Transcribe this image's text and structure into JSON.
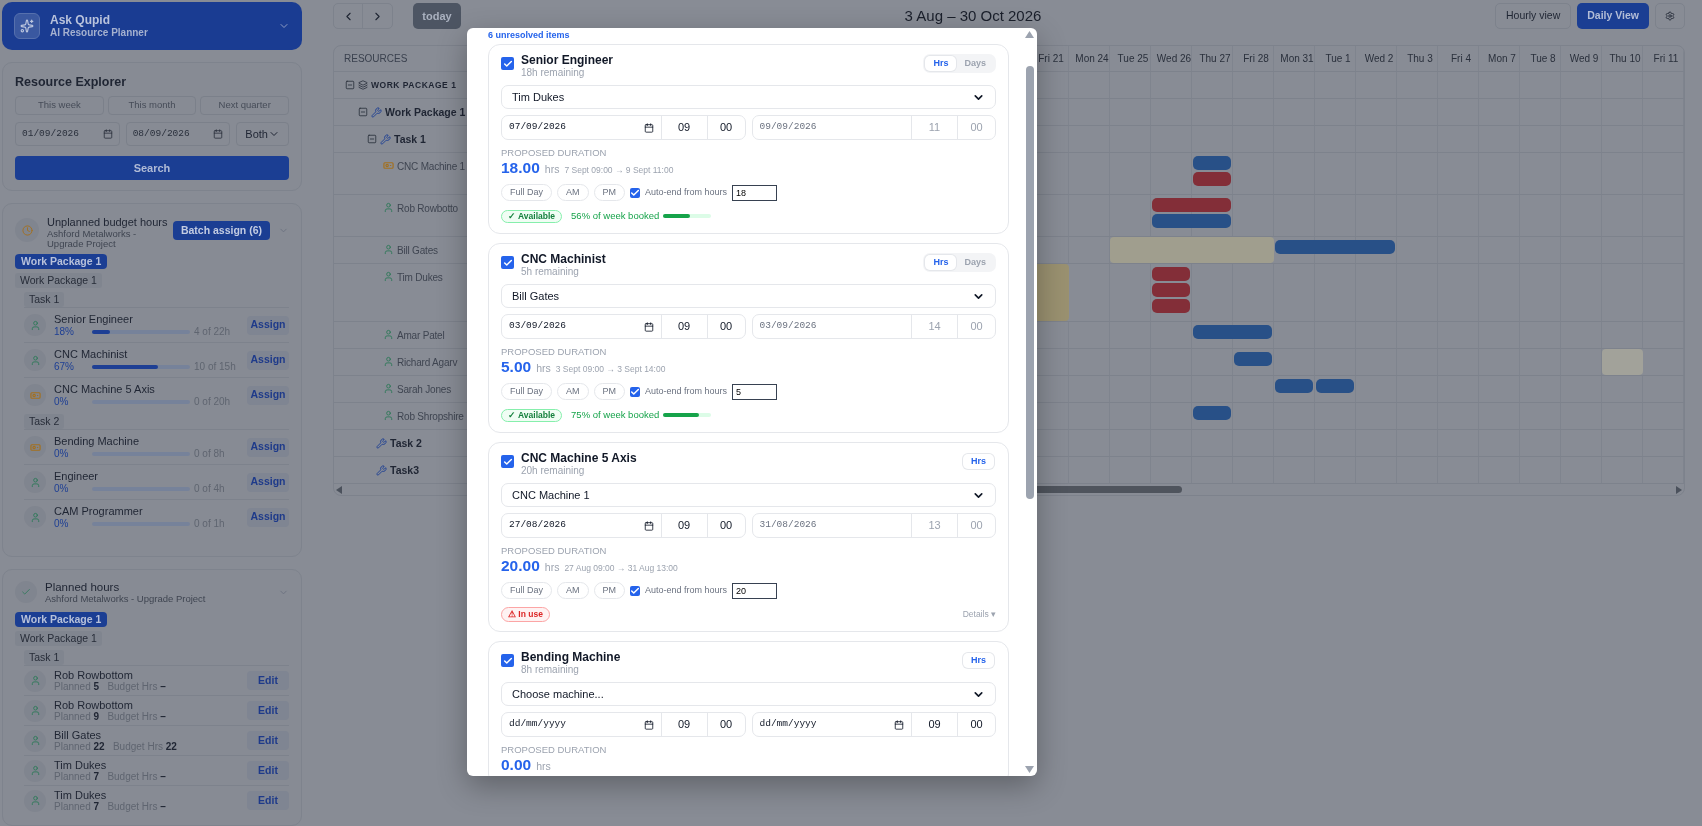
{
  "assistant": {
    "title": "Ask Qupid",
    "subtitle": "AI Resource Planner"
  },
  "explorer": {
    "title": "Resource Explorer",
    "ranges": [
      "This week",
      "This month",
      "Next quarter"
    ],
    "from": "01/09/2026",
    "to": "08/09/2026",
    "filter": "Both",
    "search": "Search"
  },
  "unplanned": {
    "title": "Unplanned budget hours",
    "subtitle": "Ashford Metalworks - Upgrade Project",
    "batch": "Batch assign (6)",
    "badge": "Work Package 1",
    "package": "Work Package 1",
    "tasks": [
      {
        "name": "Task 1",
        "items": [
          {
            "name": "Senior Engineer",
            "kind": "person",
            "percent": "18%",
            "level": 0.18,
            "hours": "4 of 22h",
            "action": "Assign"
          },
          {
            "name": "CNC Machinist",
            "kind": "person",
            "percent": "67%",
            "level": 0.67,
            "hours": "10 of 15h",
            "action": "Assign"
          },
          {
            "name": "CNC Machine 5 Axis",
            "kind": "machine",
            "percent": "0%",
            "level": 0,
            "hours": "0 of 20h",
            "action": "Assign"
          }
        ]
      },
      {
        "name": "Task 2",
        "items": [
          {
            "name": "Bending Machine",
            "kind": "machine",
            "percent": "0%",
            "level": 0,
            "hours": "0 of 8h",
            "action": "Assign"
          },
          {
            "name": "Engineer",
            "kind": "person",
            "percent": "0%",
            "level": 0,
            "hours": "0 of 4h",
            "action": "Assign"
          },
          {
            "name": "CAM Programmer",
            "kind": "person",
            "percent": "0%",
            "level": 0,
            "hours": "0 of 1h",
            "action": "Assign"
          }
        ]
      }
    ]
  },
  "planned": {
    "title": "Planned hours",
    "subtitle": "Ashford Metalworks - Upgrade Project",
    "badge": "Work Package 1",
    "package": "Work Package 1",
    "tasks": [
      {
        "name": "Task 1",
        "items": [
          {
            "name": "Rob Rowbottom",
            "kind": "person",
            "detail": "Planned **5**   Budget Hrs **–**",
            "action": "Edit"
          },
          {
            "name": "Rob Rowbottom",
            "kind": "person",
            "detail": "Planned **9**   Budget Hrs **–**",
            "action": "Edit"
          },
          {
            "name": "Bill Gates",
            "kind": "person",
            "detail": "Planned **22**   Budget Hrs **22**",
            "action": "Edit"
          },
          {
            "name": "Tim Dukes",
            "kind": "person",
            "detail": "Planned **7**   Budget Hrs **–**",
            "action": "Edit"
          },
          {
            "name": "Tim Dukes",
            "kind": "person",
            "detail": "Planned **7**   Budget Hrs **–**",
            "action": "Edit"
          }
        ]
      }
    ]
  },
  "toolbar": {
    "today": "today",
    "title": "3 Aug – 30 Oct 2026",
    "views": [
      {
        "label": "Hourly view",
        "selected": false
      },
      {
        "label": "Daily View",
        "selected": true
      }
    ]
  },
  "gantt": {
    "header": "RESOURCES",
    "days": [
      "Fri 21",
      "Mon 24",
      "Tue 25",
      "Wed 26",
      "Thu 27",
      "Fri 28",
      "Mon 31",
      "Tue 1",
      "Wed 2",
      "Thu 3",
      "Fri 4",
      "Mon 7",
      "Tue 8",
      "Wed 9",
      "Thu 10",
      "Fri 11"
    ],
    "rows": [
      {
        "label": "WORK PACKAGE 1",
        "kind": "package",
        "expanded": true,
        "children": [
          {
            "label": "Work Package 1",
            "kind": "subpackage",
            "expanded": true,
            "children": [
              {
                "label": "Task 1",
                "kind": "task",
                "expanded": true,
                "children": [
                  {
                    "label": "CNC Machine 1",
                    "kind": "machine",
                    "lanes": [
                      {
                        "bookings": [
                          {
                            "color": "#285087",
                            "days": [
                              false,
                              false,
                              false,
                              false,
                              true,
                              false,
                              false,
                              false,
                              false,
                              false,
                              false,
                              false,
                              false,
                              false,
                              false,
                              false
                            ]
                          }
                        ]
                      },
                      {
                        "bookings": [
                          {
                            "color": "#832e38",
                            "days": [
                              false,
                              false,
                              false,
                              false,
                              true,
                              false,
                              false,
                              false,
                              false,
                              false,
                              false,
                              false,
                              false,
                              false,
                              false,
                              false
                            ]
                          }
                        ]
                      }
                    ]
                  },
                  {
                    "label": "Rob Rowbotto",
                    "kind": "person",
                    "lanes": [
                      {
                        "bookings": [
                          {
                            "color": "#832e38",
                            "days": [
                              false,
                              false,
                              false,
                              true,
                              true,
                              false,
                              false,
                              false,
                              false,
                              false,
                              false,
                              false,
                              false,
                              false,
                              false,
                              false
                            ]
                          }
                        ]
                      },
                      {
                        "bookings": [
                          {
                            "color": "#285087",
                            "days": [
                              false,
                              false,
                              false,
                              true,
                              true,
                              false,
                              false,
                              false,
                              false,
                              false,
                              false,
                              false,
                              false,
                              false,
                              false,
                              false
                            ]
                          }
                        ]
                      }
                    ]
                  },
                  {
                    "label": "Bill Gates",
                    "kind": "person",
                    "blocks": [
                      {
                        "color": "#a09e8e",
                        "days": [
                          false,
                          false,
                          true,
                          true,
                          true,
                          true,
                          false,
                          false,
                          false,
                          false,
                          false,
                          false,
                          false,
                          false,
                          false,
                          false
                        ]
                      }
                    ],
                    "lanes": [
                      {
                        "bookings": [
                          {
                            "color": "#285087",
                            "days": [
                              false,
                              false,
                              false,
                              false,
                              false,
                              false,
                              true,
                              true,
                              true,
                              false,
                              false,
                              false,
                              false,
                              false,
                              false,
                              false
                            ]
                          }
                        ]
                      }
                    ]
                  },
                  {
                    "label": "Tim Dukes",
                    "kind": "person",
                    "blocks": [
                      {
                        "color": "#9a9170",
                        "days": [
                          true,
                          false,
                          false,
                          false,
                          false,
                          false,
                          false,
                          false,
                          false,
                          false,
                          false,
                          false,
                          false,
                          false,
                          false,
                          false
                        ]
                      }
                    ],
                    "lanes": [
                      {
                        "bookings": [
                          {
                            "color": "#832e38",
                            "days": [
                              false,
                              false,
                              false,
                              true,
                              false,
                              false,
                              false,
                              false,
                              false,
                              false,
                              false,
                              false,
                              false,
                              false,
                              false,
                              false
                            ]
                          }
                        ]
                      },
                      {
                        "bookings": [
                          {
                            "color": "#832e38",
                            "days": [
                              false,
                              false,
                              false,
                              true,
                              false,
                              false,
                              false,
                              false,
                              false,
                              false,
                              false,
                              false,
                              false,
                              false,
                              false,
                              false
                            ]
                          }
                        ]
                      },
                      {
                        "bookings": [
                          {
                            "color": "#832e38",
                            "days": [
                              false,
                              false,
                              false,
                              true,
                              false,
                              false,
                              false,
                              false,
                              false,
                              false,
                              false,
                              false,
                              false,
                              false,
                              false,
                              false
                            ]
                          }
                        ]
                      }
                    ]
                  },
                  {
                    "label": "Amar Patel",
                    "kind": "person",
                    "lanes": [
                      {
                        "bookings": [
                          {
                            "color": "#285087",
                            "days": [
                              false,
                              false,
                              false,
                              false,
                              true,
                              true,
                              false,
                              false,
                              false,
                              false,
                              false,
                              false,
                              false,
                              false,
                              false,
                              false
                            ]
                          }
                        ]
                      }
                    ]
                  },
                  {
                    "label": "Richard Agarv",
                    "kind": "person",
                    "blocks": [
                      {
                        "color": "#a2a29a",
                        "days": [
                          false,
                          false,
                          false,
                          false,
                          false,
                          false,
                          false,
                          false,
                          false,
                          false,
                          false,
                          false,
                          false,
                          false,
                          true,
                          false
                        ]
                      }
                    ],
                    "lanes": [
                      {
                        "bookings": [
                          {
                            "color": "#285087",
                            "days": [
                              false,
                              false,
                              false,
                              false,
                              false,
                              true,
                              false,
                              false,
                              false,
                              false,
                              false,
                              false,
                              false,
                              false,
                              false,
                              false
                            ]
                          }
                        ]
                      }
                    ]
                  },
                  {
                    "label": "Sarah Jones",
                    "kind": "person",
                    "lanes": [
                      {
                        "bookings": [
                          {
                            "color": "#285087",
                            "days": [
                              false,
                              false,
                              false,
                              false,
                              false,
                              false,
                              true,
                              false,
                              false,
                              false,
                              false,
                              false,
                              false,
                              false,
                              false,
                              false
                            ]
                          },
                          {
                            "color": "#285087",
                            "days": [
                              false,
                              false,
                              false,
                              false,
                              false,
                              false,
                              false,
                              true,
                              false,
                              false,
                              false,
                              false,
                              false,
                              false,
                              false,
                              false
                            ]
                          }
                        ]
                      }
                    ]
                  },
                  {
                    "label": "Rob Shropshire",
                    "kind": "person",
                    "lanes": [
                      {
                        "bookings": [
                          {
                            "color": "#285087",
                            "days": [
                              false,
                              false,
                              false,
                              false,
                              true,
                              false,
                              false,
                              false,
                              false,
                              false,
                              false,
                              false,
                              false,
                              false,
                              false,
                              false
                            ]
                          }
                        ]
                      }
                    ]
                  }
                ]
              },
              {
                "label": "Task 2",
                "kind": "task"
              },
              {
                "label": "Task3",
                "kind": "task"
              }
            ]
          }
        ]
      }
    ]
  },
  "modal": {
    "unresolved": "6 unresolved items",
    "cards": [
      {
        "title": "Senior Engineer",
        "remaining": "18h remaining",
        "checked": true,
        "units": [
          {
            "label": "Hrs",
            "selected": true
          },
          {
            "label": "Days",
            "selected": false
          }
        ],
        "assignee": "Tim Dukes",
        "start": {
          "date": "07/09/2026",
          "hour": "09",
          "minute": "00"
        },
        "end": {
          "date": "09/09/2026",
          "hour": "11",
          "minute": "00",
          "locked": true
        },
        "duration_label": "PROPOSED DURATION",
        "duration": "18.00",
        "unit": "hrs",
        "range": "7 Sept 09:00 → 9 Sept 11:00",
        "presets": [
          "Full Day",
          "AM",
          "PM"
        ],
        "auto_end": {
          "label": "Auto-end from hours",
          "checked": true,
          "value": "18"
        },
        "status": {
          "kind": "available",
          "badge": "✓ Available",
          "booked": "56% of week booked",
          "level": 0.56
        }
      },
      {
        "title": "CNC Machinist",
        "remaining": "5h remaining",
        "checked": true,
        "units": [
          {
            "label": "Hrs",
            "selected": true
          },
          {
            "label": "Days",
            "selected": false
          }
        ],
        "assignee": "Bill Gates",
        "start": {
          "date": "03/09/2026",
          "hour": "09",
          "minute": "00"
        },
        "end": {
          "date": "03/09/2026",
          "hour": "14",
          "minute": "00",
          "locked": true
        },
        "duration_label": "PROPOSED DURATION",
        "duration": "5.00",
        "unit": "hrs",
        "range": "3 Sept 09:00 → 3 Sept 14:00",
        "presets": [
          "Full Day",
          "AM",
          "PM"
        ],
        "auto_end": {
          "label": "Auto-end from hours",
          "checked": true,
          "value": "5"
        },
        "status": {
          "kind": "available",
          "badge": "✓ Available",
          "booked": "75% of week booked",
          "level": 0.75
        }
      },
      {
        "title": "CNC Machine 5 Axis",
        "remaining": "20h remaining",
        "checked": true,
        "units": [
          {
            "label": "Hrs",
            "selected": true
          }
        ],
        "assignee": "CNC Machine 1",
        "start": {
          "date": "27/08/2026",
          "hour": "09",
          "minute": "00"
        },
        "end": {
          "date": "31/08/2026",
          "hour": "13",
          "minute": "00",
          "locked": true
        },
        "duration_label": "PROPOSED DURATION",
        "duration": "20.00",
        "unit": "hrs",
        "range": "27 Aug 09:00 → 31 Aug 13:00",
        "presets": [
          "Full Day",
          "AM",
          "PM"
        ],
        "auto_end": {
          "label": "Auto-end from hours",
          "checked": true,
          "value": "20"
        },
        "status": {
          "kind": "in_use",
          "badge": "⚠ In use",
          "details": "Details ▾"
        }
      },
      {
        "title": "Bending Machine",
        "remaining": "8h remaining",
        "checked": true,
        "units": [
          {
            "label": "Hrs",
            "selected": true
          }
        ],
        "assignee": "Choose machine...",
        "start": {
          "placeholder": "dd/mm/yyyy",
          "hour": "09",
          "minute": "00"
        },
        "end": {
          "placeholder": "dd/mm/yyyy",
          "hour": "09",
          "minute": "00",
          "locked": false
        },
        "duration_label": "PROPOSED DURATION",
        "duration": "0.00",
        "unit": "hrs"
      }
    ]
  }
}
